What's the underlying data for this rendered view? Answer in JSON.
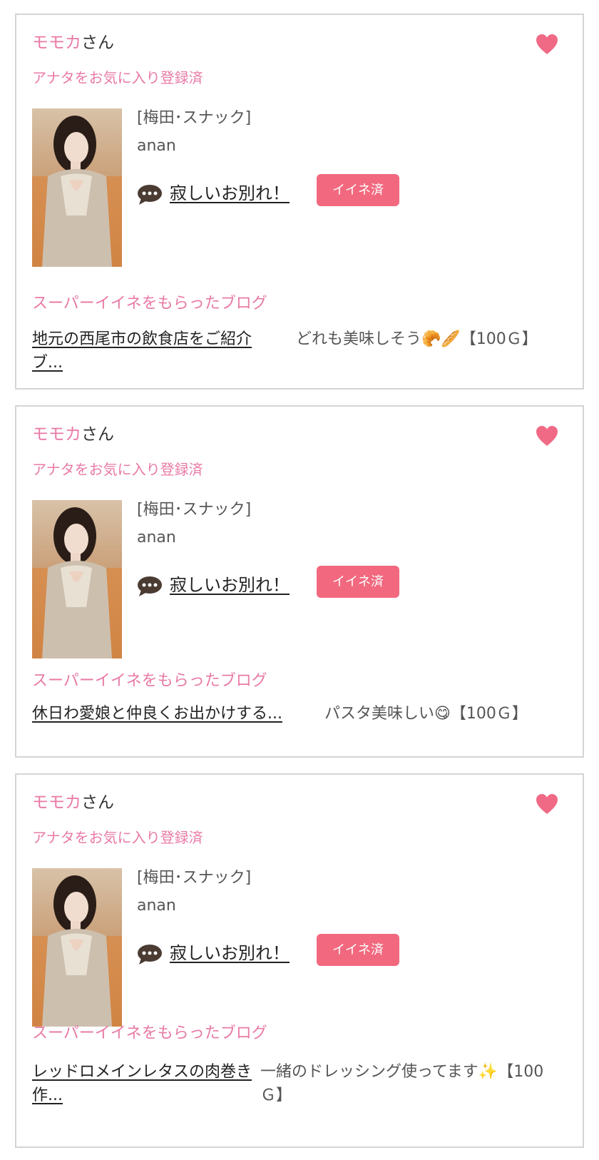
{
  "colors": {
    "accent_pink": "#e87aa6",
    "badge_pink": "#f2697f",
    "heart_pink": "#f06a86",
    "border": "#d4d4d4"
  },
  "cards": [
    {
      "user_name": "モモカ",
      "user_suffix": "さん",
      "favorite_status": "アナタをお気に入り登録済",
      "shop_tag": "[梅田･スナック]",
      "shop_name": "anan",
      "post_title": "寂しいお別れ！",
      "iine_label": "イイネ済",
      "blog_heading": "スーパーイイネをもらったブログ",
      "blog_title": "地元の西尾市の飲食店をご紹介ブ...",
      "blog_comment": "どれも美味しそう🥐🥖【100Ｇ】",
      "icons": [
        "heart-icon",
        "chat-bubble-icon"
      ]
    },
    {
      "user_name": "モモカ",
      "user_suffix": "さん",
      "favorite_status": "アナタをお気に入り登録済",
      "shop_tag": "[梅田･スナック]",
      "shop_name": "anan",
      "post_title": "寂しいお別れ！",
      "iine_label": "イイネ済",
      "blog_heading": "スーパーイイネをもらったブログ",
      "blog_title": "休日わ愛娘と仲良くお出かけする...",
      "blog_comment": "パスタ美味しい😋【100Ｇ】",
      "icons": [
        "heart-icon",
        "chat-bubble-icon"
      ]
    },
    {
      "user_name": "モモカ",
      "user_suffix": "さん",
      "favorite_status": "アナタをお気に入り登録済",
      "shop_tag": "[梅田･スナック]",
      "shop_name": "anan",
      "post_title": "寂しいお別れ！",
      "iine_label": "イイネ済",
      "blog_heading": "スーパーイイネをもらったブログ",
      "blog_title": "レッドロメインレタスの肉巻き作...",
      "blog_comment": "一緒のドレッシング使ってます✨【100Ｇ】",
      "icons": [
        "heart-icon",
        "chat-bubble-icon"
      ]
    }
  ]
}
